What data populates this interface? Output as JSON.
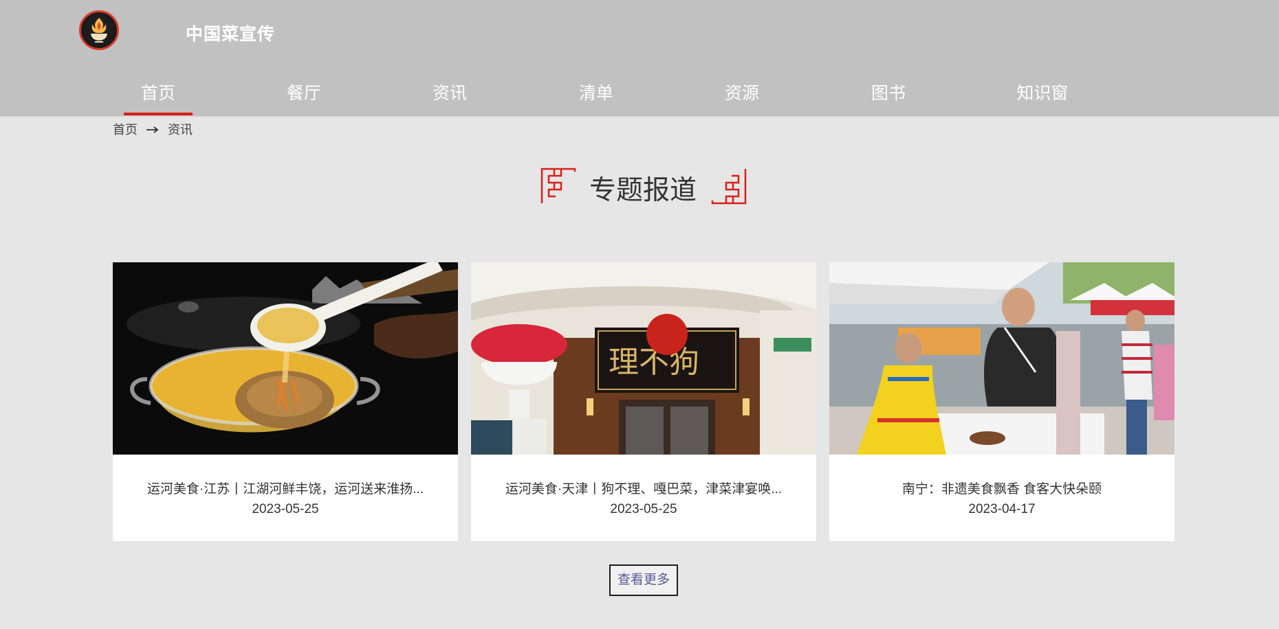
{
  "site": {
    "title": "中国菜宣传",
    "logo_icon": "flame-bowl-logo-icon"
  },
  "nav": {
    "items": [
      {
        "label": "首页",
        "active": true
      },
      {
        "label": "餐厅",
        "active": false
      },
      {
        "label": "资讯",
        "active": false
      },
      {
        "label": "清单",
        "active": false
      },
      {
        "label": "资源",
        "active": false
      },
      {
        "label": "图书",
        "active": false
      },
      {
        "label": "知识窗",
        "active": false
      }
    ]
  },
  "breadcrumb": {
    "home": "首页",
    "separator_icon": "arrow-right-icon",
    "current": "资讯"
  },
  "section": {
    "title": "专题报道"
  },
  "cards": [
    {
      "title": "运河美食·江苏丨江湖河鲜丰饶，运河送来淮扬...",
      "date": "2023-05-25",
      "image": "food-soup-photo"
    },
    {
      "title": "运河美食·天津丨狗不理、嘎巴菜，津菜津宴唤...",
      "date": "2023-05-25",
      "image": "restaurant-storefront-photo"
    },
    {
      "title": "南宁：非遗美食飘香 食客大快朵颐",
      "date": "2023-04-17",
      "image": "food-fair-photo"
    }
  ],
  "more_button": {
    "label": "查看更多"
  },
  "colors": {
    "header_bg": "#c1c1c1",
    "page_bg": "#e6e6e6",
    "accent_red": "#d91e18",
    "more_text": "#5a5a9a"
  }
}
